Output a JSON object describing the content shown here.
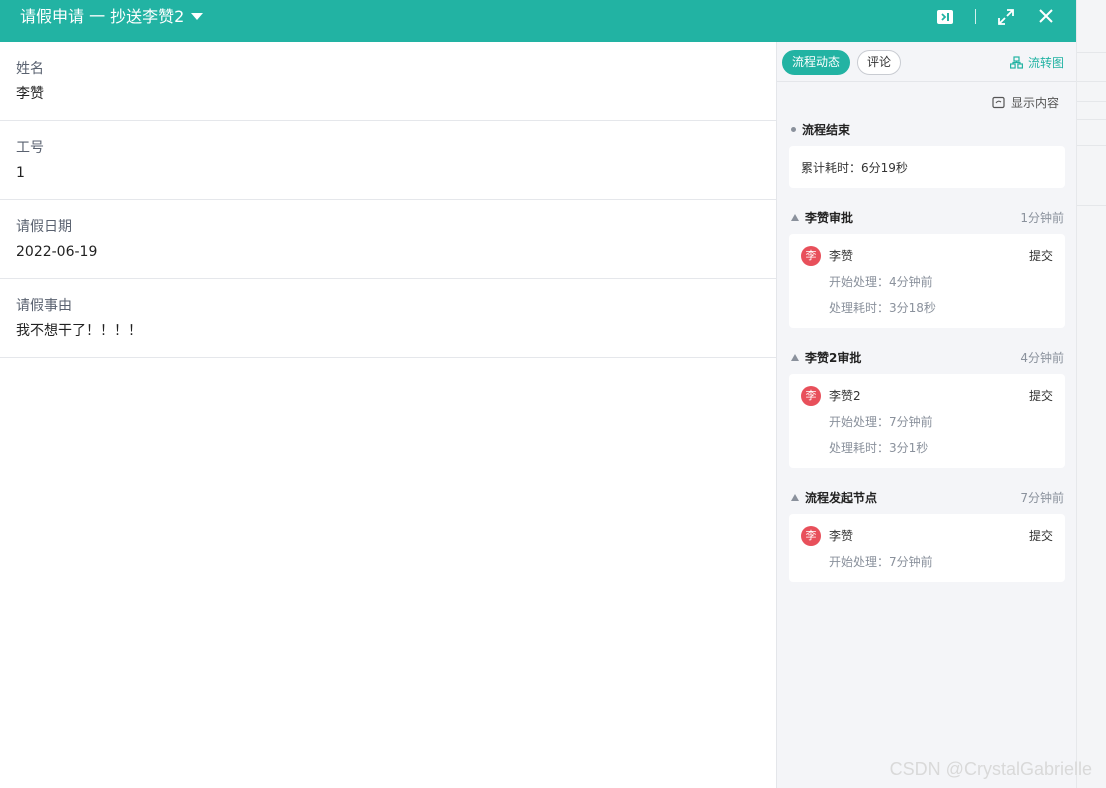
{
  "header": {
    "title": "请假申请 一 抄送李赞2"
  },
  "form": {
    "fields": [
      {
        "label": "姓名",
        "value": "李赞"
      },
      {
        "label": "工号",
        "value": "1"
      },
      {
        "label": "请假日期",
        "value": "2022-06-19"
      },
      {
        "label": "请假事由",
        "value": "我不想干了！！！！"
      }
    ]
  },
  "panel": {
    "tabs": [
      {
        "label": "流程动态"
      },
      {
        "label": "评论"
      }
    ],
    "flowchart_label": "流转图",
    "show_content_label": "显示内容",
    "end_node": {
      "title": "流程结束",
      "summary": "累计耗时：6分19秒"
    },
    "nodes": [
      {
        "title": "李赞审批",
        "time": "1分钟前",
        "avatar": "李",
        "person": "李赞",
        "action": "提交",
        "start": "开始处理：4分钟前",
        "duration": "处理耗时：3分18秒"
      },
      {
        "title": "李赞2审批",
        "time": "4分钟前",
        "avatar": "李",
        "person": "李赞2",
        "action": "提交",
        "start": "开始处理：7分钟前",
        "duration": "处理耗时：3分1秒"
      },
      {
        "title": "流程发起节点",
        "time": "7分钟前",
        "avatar": "李",
        "person": "李赞",
        "action": "提交",
        "start": "开始处理：7分钟前"
      }
    ]
  },
  "watermark": "CSDN @CrystalGabrielle",
  "colors": {
    "accent": "#22b3a3",
    "avatar": "#e8505b"
  }
}
